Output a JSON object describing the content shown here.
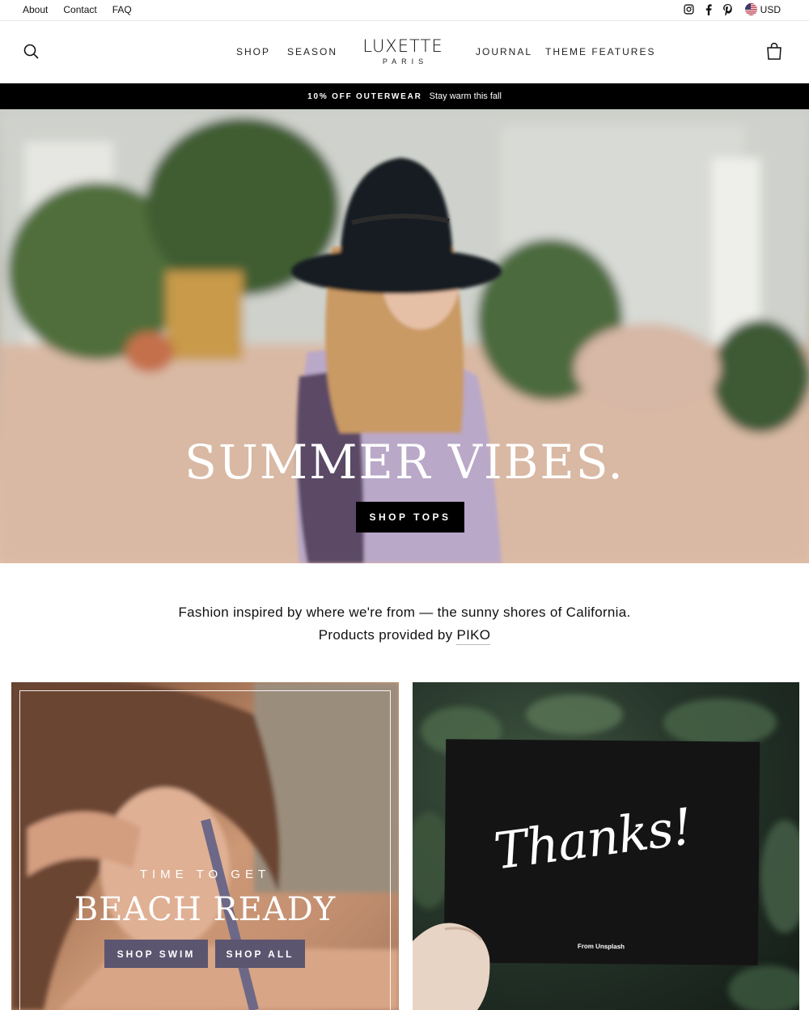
{
  "utility": {
    "links": [
      "About",
      "Contact",
      "FAQ"
    ],
    "currency": "USD"
  },
  "header": {
    "logo_main": "LUXETTE",
    "logo_sub": "PARIS",
    "nav": [
      "SHOP",
      "SEASON",
      "JOURNAL",
      "THEME FEATURES"
    ]
  },
  "announcement": {
    "bold": "10% OFF OUTERWEAR",
    "text": "Stay warm this fall"
  },
  "hero": {
    "title": "SUMMER VIBES.",
    "button": "SHOP TOPS"
  },
  "intro": {
    "line1": "Fashion inspired by where we're from — the sunny shores of California.",
    "line2_prefix": "Products provided by ",
    "line2_link": "PIKO"
  },
  "promo_left": {
    "eyebrow": "TIME TO GET",
    "heading": "BEACH READY",
    "button1": "SHOP SWIM",
    "button2": "SHOP ALL"
  },
  "promo_right": {
    "card_script": "Thanks!",
    "card_credit": "From Unsplash"
  },
  "colors": {
    "announcement_bg": "#000000",
    "hero_button_bg": "#000000",
    "promo_button_bg": "#5c5570"
  },
  "icons": [
    "search-icon",
    "cart-icon",
    "instagram-icon",
    "facebook-icon",
    "pinterest-icon",
    "us-flag-icon"
  ]
}
